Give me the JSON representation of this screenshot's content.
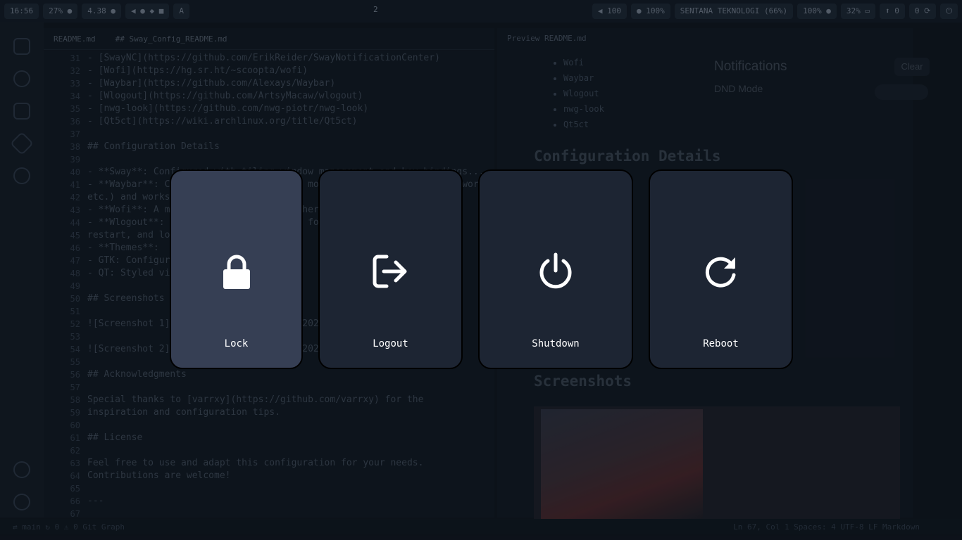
{
  "topbar": {
    "left_modules": [
      "16:56",
      "27% ●",
      "4.38 ●",
      "◀  ●  ◆  ■",
      "A"
    ],
    "center": "2",
    "right_modules": [
      "◀ 100",
      "● 100%",
      "SENTANA TEKNOLOGI (66%)",
      "100% ●",
      "32% ▭",
      "⬆ 0",
      "0 ⟳",
      "⏻"
    ]
  },
  "editor": {
    "tabs": [
      "README.md",
      "## Sway_Config_README.md"
    ],
    "line_numbers": [
      "31",
      "32",
      "33",
      "34",
      "35",
      "36",
      "37",
      "38",
      "39",
      "40",
      "41",
      "42",
      "43",
      "44",
      "45",
      "46",
      "47",
      "48",
      "49",
      "50",
      "51",
      "52",
      "53",
      "54",
      "55",
      "56",
      "57",
      "58",
      "59",
      "60",
      "61",
      "62",
      "63",
      "64",
      "65",
      "66",
      "67"
    ],
    "lines": [
      "- [SwayNC](https://github.com/ErikReider/SwayNotificationCenter)",
      "- [Wofi](https://hg.sr.ht/~scoopta/wofi)",
      "- [Waybar](https://github.com/Alexays/Waybar)",
      "- [Wlogout](https://github.com/ArtsyMacaw/wlogout)",
      "- [nwg-look](https://github.com/nwg-piotr/nwg-look)",
      "- [Qt5ct](https://wiki.archlinux.org/title/Qt5ct)",
      "",
      "## Configuration Details",
      "",
      "- **Sway**: Configured with tiling window management and key bindings...",
      "- **Waybar**: Custom modules for system monitoring (CPU, memory, network,",
      "etc.) and workspace indicators.",
      "- **Wofi**: A minimal application launcher with custom styling",
      "- **Wlogout**: Logout menu with options for lock, logout, shutdown,",
      "restart, and lock screen.",
      "- **Themes**:",
      "  - GTK: Configured via nwg-look",
      "  - QT: Styled via Qt5ct",
      "",
      "## Screenshots",
      "",
      "![Screenshot 1](screenshots/Screenshot_20241231.png)",
      "",
      "![Screenshot 2](screenshots/Screenshot_20241231.png)",
      "",
      "## Acknowledgments",
      "",
      "Special thanks to [varrxy](https://github.com/varrxy) for the",
      "inspiration and configuration tips.",
      "",
      "## License",
      "",
      "Feel free to use and adapt this configuration for your needs.",
      "Contributions are welcome!",
      "",
      "---",
      ""
    ]
  },
  "preview": {
    "tab": "Preview README.md",
    "list": [
      "Wofi",
      "Waybar",
      "Wlogout",
      "nwg-look",
      "Qt5ct"
    ],
    "heading1": "Configuration Details",
    "heading2": "Screenshots"
  },
  "notifications": {
    "title": "Notifications",
    "dnd_label": "DND Mode",
    "clear_label": "Clear"
  },
  "statusbar": {
    "left": "⇄  main  ↻  0 ⚠ 0  Git Graph",
    "right": "Ln 67, Col 1  Spaces: 4  UTF-8  LF  Markdown"
  },
  "power_menu": {
    "items": [
      {
        "label": "Lock",
        "icon": "lock-icon"
      },
      {
        "label": "Logout",
        "icon": "logout-icon"
      },
      {
        "label": "Shutdown",
        "icon": "power-icon"
      },
      {
        "label": "Reboot",
        "icon": "reboot-icon"
      }
    ],
    "selected": "Lock",
    "colors": {
      "button_bg": "#1d2533",
      "selected_bg": "#363f54",
      "border": "#000000",
      "label": "#ffffff"
    }
  }
}
